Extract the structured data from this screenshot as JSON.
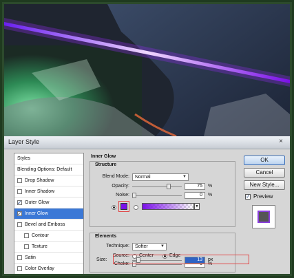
{
  "dialog": {
    "title": "Layer Style",
    "close_glyph": "×"
  },
  "styles_list": {
    "items": [
      {
        "label": "Styles",
        "checkbox": false,
        "checked": false,
        "selected": false,
        "indent": 0
      },
      {
        "label": "Blending Options: Default",
        "checkbox": false,
        "checked": false,
        "selected": false,
        "indent": 0
      },
      {
        "label": "Drop Shadow",
        "checkbox": true,
        "checked": false,
        "selected": false,
        "indent": 0
      },
      {
        "label": "Inner Shadow",
        "checkbox": true,
        "checked": false,
        "selected": false,
        "indent": 0
      },
      {
        "label": "Outer Glow",
        "checkbox": true,
        "checked": true,
        "selected": false,
        "indent": 0
      },
      {
        "label": "Inner Glow",
        "checkbox": true,
        "checked": true,
        "selected": true,
        "indent": 0
      },
      {
        "label": "Bevel and Emboss",
        "checkbox": true,
        "checked": false,
        "selected": false,
        "indent": 0
      },
      {
        "label": "Contour",
        "checkbox": true,
        "checked": false,
        "selected": false,
        "indent": 1
      },
      {
        "label": "Texture",
        "checkbox": true,
        "checked": false,
        "selected": false,
        "indent": 1
      },
      {
        "label": "Satin",
        "checkbox": true,
        "checked": false,
        "selected": false,
        "indent": 0
      },
      {
        "label": "Color Overlay",
        "checkbox": true,
        "checked": false,
        "selected": false,
        "indent": 0
      }
    ]
  },
  "inner_glow": {
    "title": "Inner Glow",
    "structure": {
      "title": "Structure",
      "blend_mode_label": "Blend Mode:",
      "blend_mode_value": "Normal",
      "opacity_label": "Opacity:",
      "opacity_value": "75",
      "opacity_level": 75,
      "noise_label": "Noise:",
      "noise_value": "0",
      "noise_level": 0,
      "percent": "%",
      "glow_color": "#7a10e8",
      "gradient_from": "#7a10e8"
    },
    "elements": {
      "title": "Elements",
      "technique_label": "Technique:",
      "technique_value": "Softer",
      "source_label": "Source:",
      "source_center": "Center",
      "source_edge": "Edge",
      "source_selected": "Edge",
      "choke_label": "Choke:",
      "choke_value": "0",
      "choke_level": 0,
      "size_label": "Size:",
      "size_value": "13",
      "size_unit": "px",
      "percent": "%"
    }
  },
  "buttons": {
    "ok": "OK",
    "cancel": "Cancel",
    "new_style": "New Style...",
    "preview": "Preview",
    "preview_checked": true
  },
  "colors": {
    "highlight": "#e04848",
    "selection": "#3b78d6",
    "beam": "#a64dff"
  }
}
